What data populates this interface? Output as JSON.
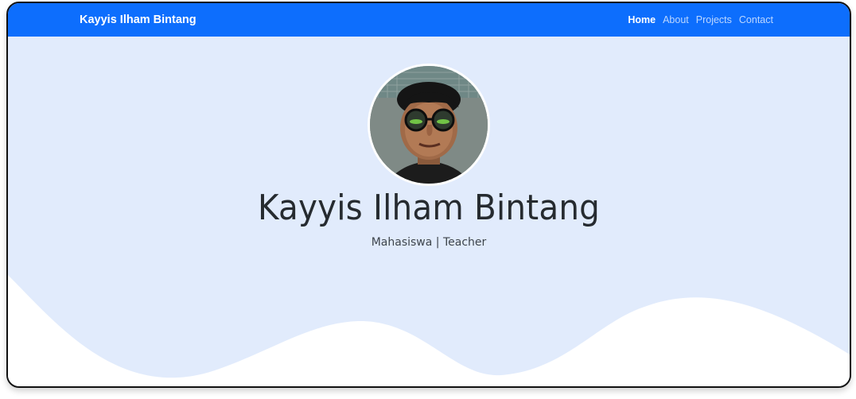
{
  "navbar": {
    "brand": "Kayyis Ilham Bintang",
    "links": [
      "Home",
      "About",
      "Projects",
      "Contact"
    ],
    "active": "Home",
    "background_color": "#0d6efd"
  },
  "hero": {
    "name": "Kayyis Ilham Bintang",
    "subtitle": "Mahasiswa | Teacher",
    "background_color": "#e1ebfc",
    "wave_color": "#ffffff"
  }
}
